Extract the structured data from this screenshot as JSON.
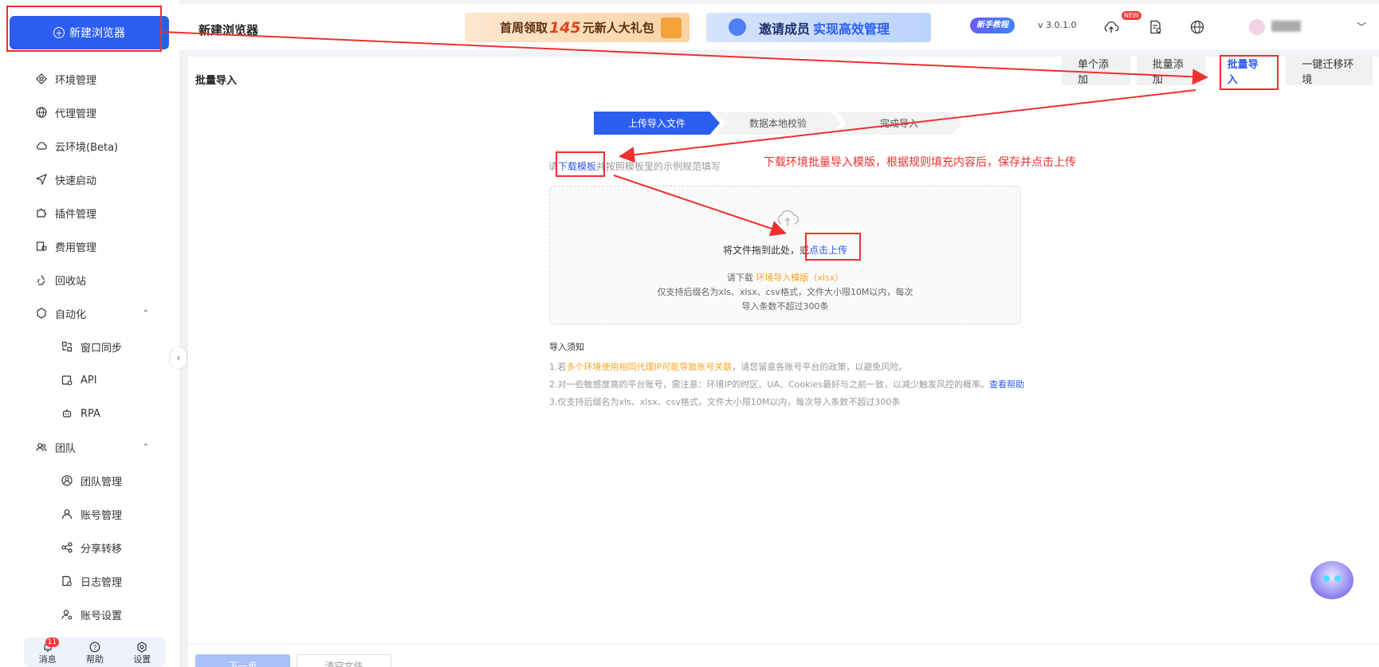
{
  "sidebar": {
    "new_button_label": "新建浏览器",
    "items": [
      {
        "label": "环境管理",
        "icon": "environment-icon"
      },
      {
        "label": "代理管理",
        "icon": "globe-icon"
      },
      {
        "label": "云环境(Beta)",
        "icon": "cloud-icon"
      },
      {
        "label": "快速启动",
        "icon": "send-icon"
      },
      {
        "label": "插件管理",
        "icon": "puzzle-icon"
      },
      {
        "label": "费用管理",
        "icon": "billing-icon"
      },
      {
        "label": "回收站",
        "icon": "recycle-icon"
      },
      {
        "label": "自动化",
        "icon": "automation-icon"
      },
      {
        "label": "窗口同步",
        "icon": "window-sync-icon"
      },
      {
        "label": "API",
        "icon": "api-icon"
      },
      {
        "label": "RPA",
        "icon": "robot-icon"
      },
      {
        "label": "团队",
        "icon": "team-icon"
      },
      {
        "label": "团队管理",
        "icon": "team-manage-icon"
      },
      {
        "label": "账号管理",
        "icon": "user-icon"
      },
      {
        "label": "分享转移",
        "icon": "share-icon"
      },
      {
        "label": "日志管理",
        "icon": "log-icon"
      },
      {
        "label": "账号设置",
        "icon": "user-settings-icon"
      }
    ],
    "bottom": {
      "messages_label": "消息",
      "messages_count": "11",
      "help_label": "帮助",
      "settings_label": "设置"
    }
  },
  "header": {
    "title": "新建浏览器",
    "banner1_prefix": "首周领取",
    "banner1_amount": "145",
    "banner1_suffix": "元新人大礼包",
    "banner2_prefix": "邀请成员",
    "banner2_highlight": "实现高效管理",
    "tutorial_badge": "新手教程",
    "version": "v 3.0.1.0",
    "new_tag": "NEW"
  },
  "main": {
    "panel_title": "批量导入",
    "tabs": [
      "单个添加",
      "批量添加",
      "批量导入",
      "一键迁移环境"
    ],
    "active_tab": "批量导入",
    "steps": [
      "上传导入文件",
      "数据本地校验",
      "完成导入"
    ],
    "hint_prefix": "请",
    "hint_link": "下载模板",
    "hint_suffix": "并按照模板里的示例规范填写",
    "drop_text": "将文件拖到此处，或",
    "drop_link": "点击上传",
    "drop_sub1_prefix": "请下载",
    "drop_sub1_link": "环境导入模版（xlsx）",
    "drop_sub2": "仅支持后缀名为xls、xlsx、csv格式，文件大小限10M以内，每次",
    "drop_sub3": "导入条数不超过300条",
    "notice_title": "导入须知",
    "notice1_prefix": "1.若",
    "notice1_highlight": "多个环境使用相同代理IP可能导致账号关联",
    "notice1_suffix": "，请您留意各账号平台的政策，以避免风险。",
    "notice2_text": "2.对一些敏感度高的平台账号，需注意：环境IP的时区、UA、Cookies最好与之前一致，以减少触发风控的概率。",
    "notice2_link": "查看帮助",
    "notice3": "3.仅支持后缀名为xls、xlsx、csv格式，文件大小限10M以内，每次导入条数不超过300条"
  },
  "annotation": {
    "instruction": "下载环境批量导入模版，根据规则填充内容后，保存并点击上传"
  },
  "footer": {
    "next_label": "下一步",
    "clear_label": "清空文件"
  },
  "colors": {
    "primary": "#2b5df0",
    "annotation_red": "#f02f2f",
    "highlight_orange": "#f5a623"
  }
}
